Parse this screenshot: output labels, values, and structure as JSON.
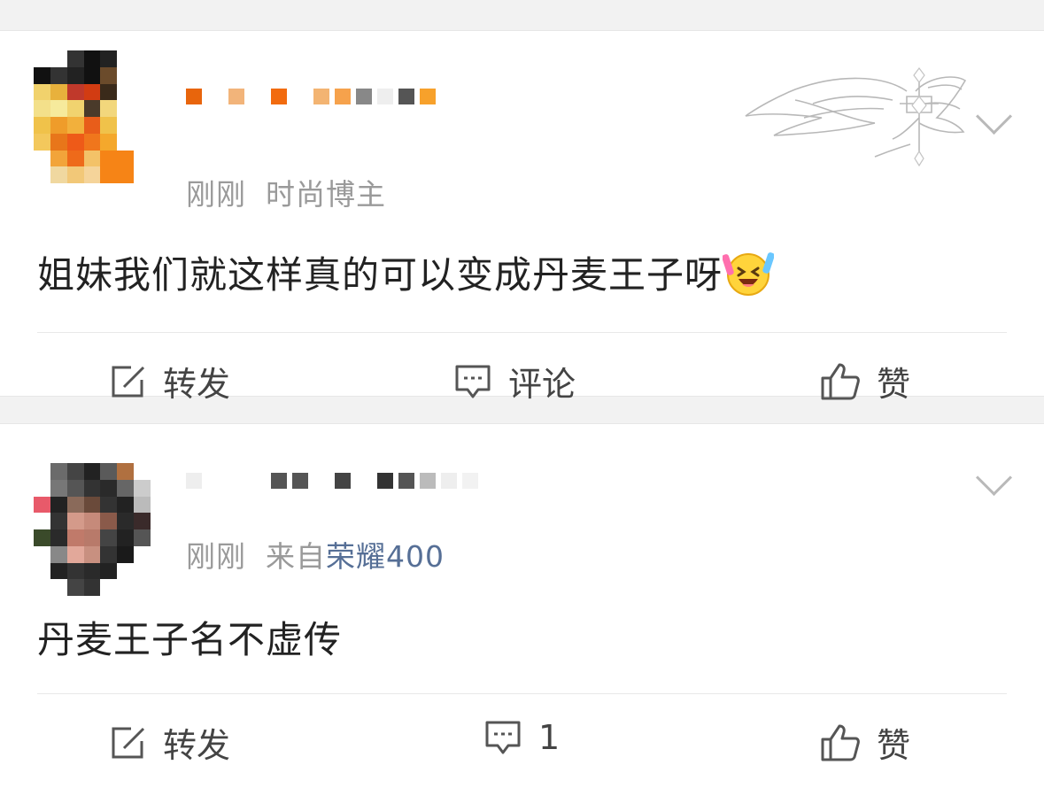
{
  "posts": [
    {
      "meta_time": "刚刚",
      "meta_source": "时尚博主",
      "content": "姐妹我们就这样真的可以变成丹麦王子呀",
      "emoji_icon": "laughing-party-emoji",
      "actions": {
        "repost": "转发",
        "comment": "评论",
        "like": "赞"
      }
    },
    {
      "meta_time": "刚刚",
      "meta_from": "来自",
      "meta_device": "荣耀400",
      "content": "丹麦王子名不虚传",
      "actions": {
        "repost": "转发",
        "comment": "1",
        "like": "赞"
      }
    }
  ],
  "colors": {
    "link": "#566f96",
    "meta": "#9a9a9a",
    "text": "#222222"
  }
}
